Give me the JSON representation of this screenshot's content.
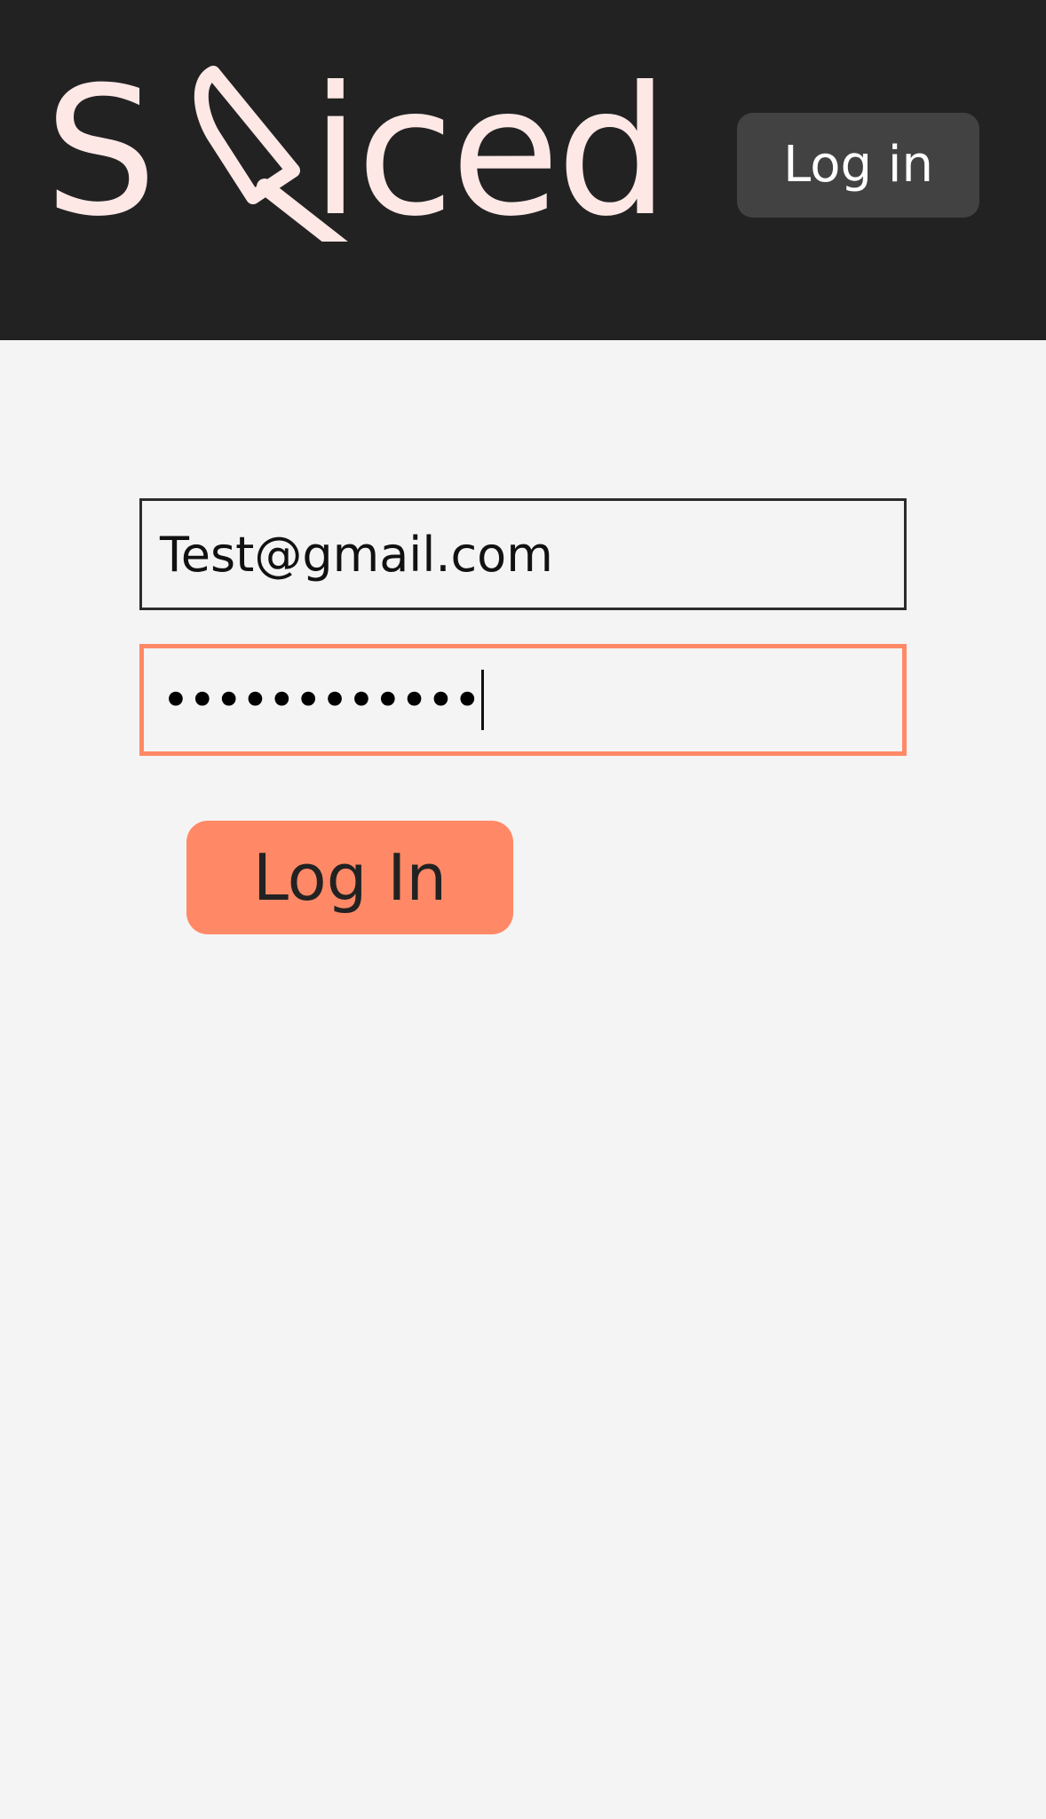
{
  "header": {
    "logo_text_start": "S",
    "logo_text_end": "iced",
    "login_label": "Log in"
  },
  "form": {
    "email_value": "Test@gmail.com",
    "password_masked": "••••••••••••",
    "submit_label": "Log In"
  },
  "colors": {
    "header_bg": "#222222",
    "page_bg": "#f4f4f4",
    "accent": "#ff8966",
    "logo": "#fde8e6",
    "header_button_bg": "#424242"
  },
  "icons": {
    "logo_knife": "knife-icon"
  }
}
